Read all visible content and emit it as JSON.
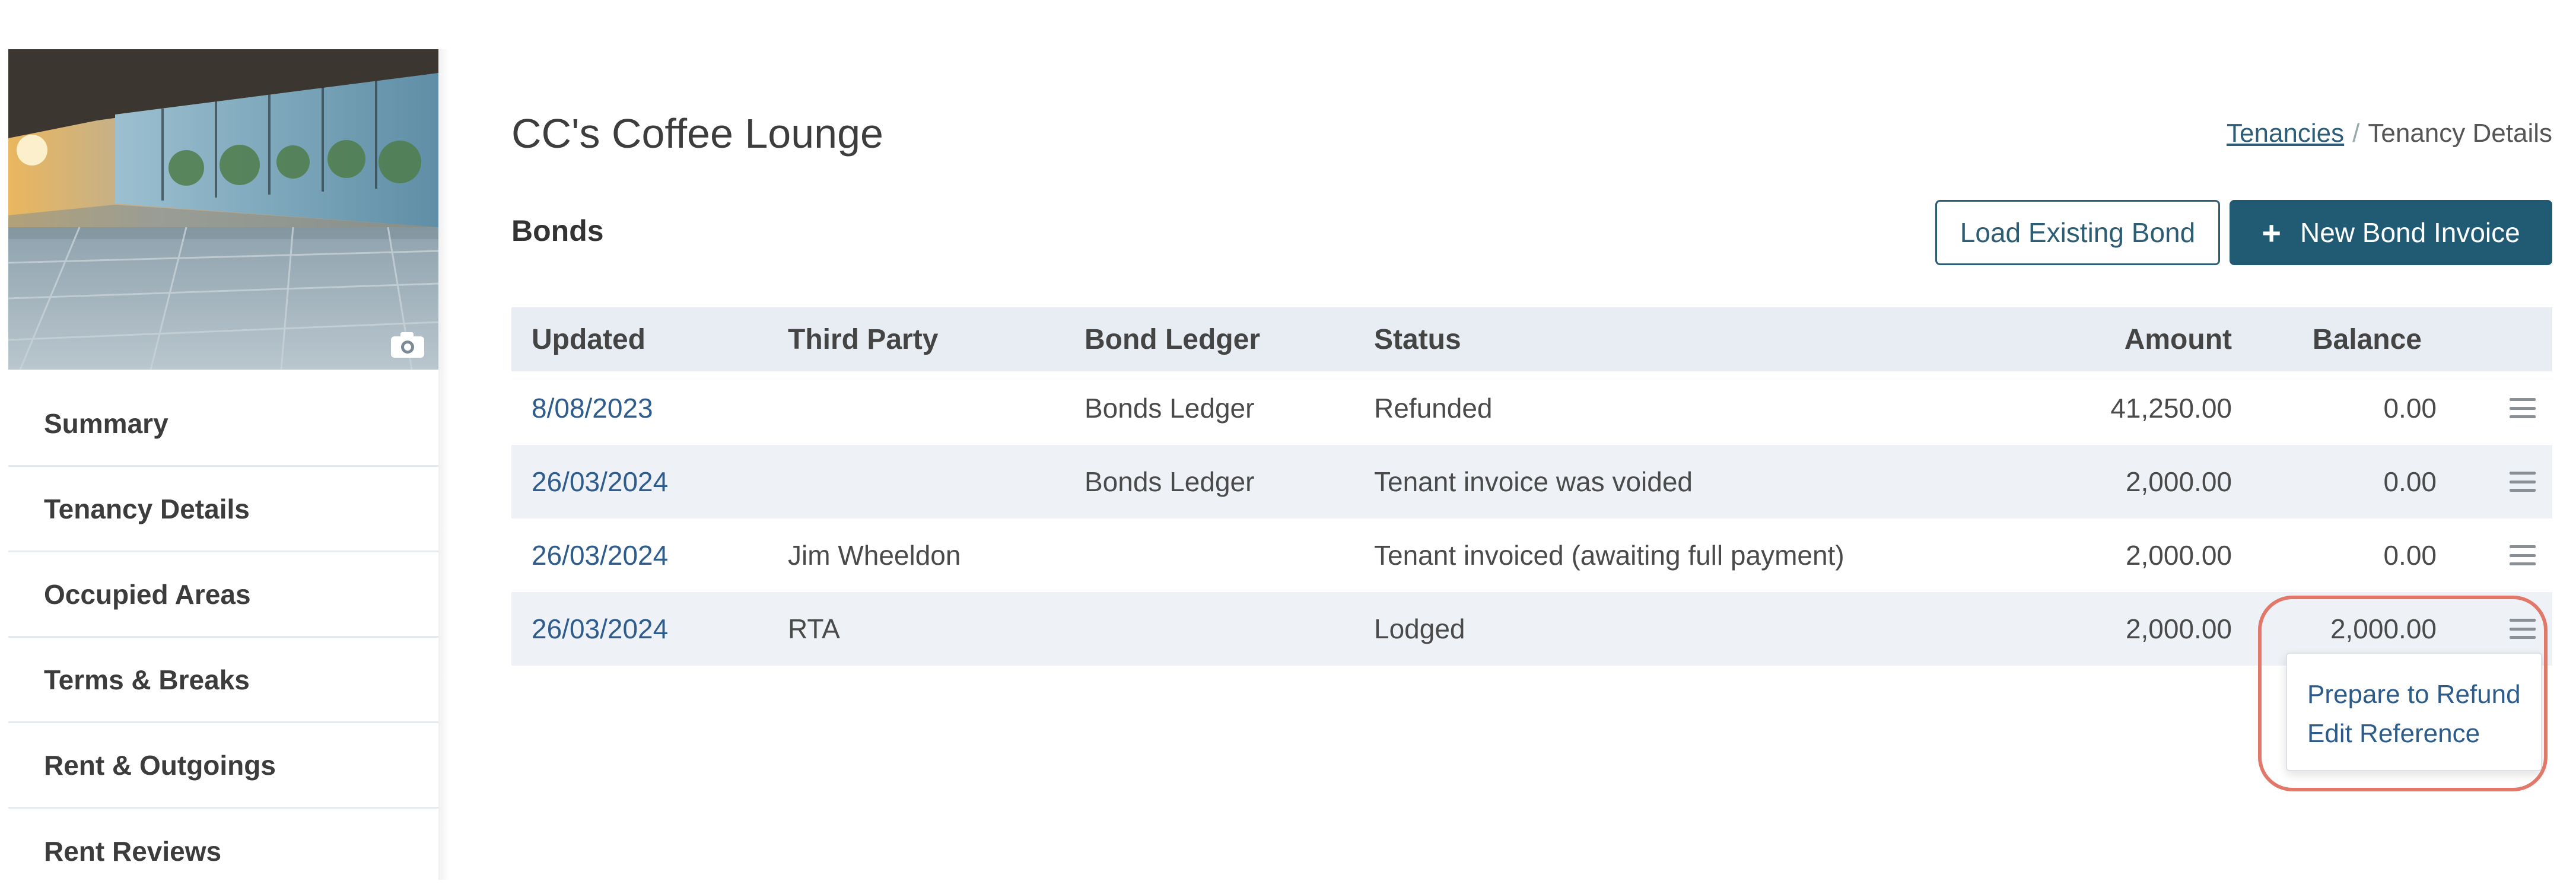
{
  "sidebar": {
    "items": [
      {
        "label": "Summary"
      },
      {
        "label": "Tenancy Details"
      },
      {
        "label": "Occupied Areas"
      },
      {
        "label": "Terms & Breaks"
      },
      {
        "label": "Rent & Outgoings"
      },
      {
        "label": "Rent Reviews"
      }
    ]
  },
  "header": {
    "title": "CC's Coffee Lounge",
    "breadcrumb": {
      "link": "Tenancies",
      "separator": "/",
      "current": "Tenancy Details"
    }
  },
  "bonds": {
    "section_title": "Bonds",
    "load_button": "Load Existing Bond",
    "new_button": "New Bond Invoice",
    "new_button_icon": "+",
    "columns": {
      "updated": "Updated",
      "third_party": "Third Party",
      "bond_ledger": "Bond Ledger",
      "status": "Status",
      "amount": "Amount",
      "balance": "Balance"
    },
    "rows": [
      {
        "updated": "8/08/2023",
        "third_party": "",
        "bond_ledger": "Bonds Ledger",
        "status": "Refunded",
        "amount": "41,250.00",
        "balance": "0.00"
      },
      {
        "updated": "26/03/2024",
        "third_party": "",
        "bond_ledger": "Bonds Ledger",
        "status": "Tenant invoice was voided",
        "amount": "2,000.00",
        "balance": "0.00"
      },
      {
        "updated": "26/03/2024",
        "third_party": "Jim Wheeldon",
        "bond_ledger": "",
        "status": "Tenant invoiced (awaiting full payment)",
        "amount": "2,000.00",
        "balance": "0.00"
      },
      {
        "updated": "26/03/2024",
        "third_party": "RTA",
        "bond_ledger": "",
        "status": "Lodged",
        "amount": "2,000.00",
        "balance": "2,000.00"
      }
    ],
    "row_menu": {
      "items": [
        "Prepare to Refund",
        "Edit Reference"
      ]
    }
  },
  "colors": {
    "primary": "#215a73",
    "link": "#2e5c8c",
    "header_row": "#e8edf4",
    "highlight": "#e2786a"
  },
  "icons": {
    "camera": "camera-icon",
    "row_menu": "hamburger-menu-icon"
  }
}
